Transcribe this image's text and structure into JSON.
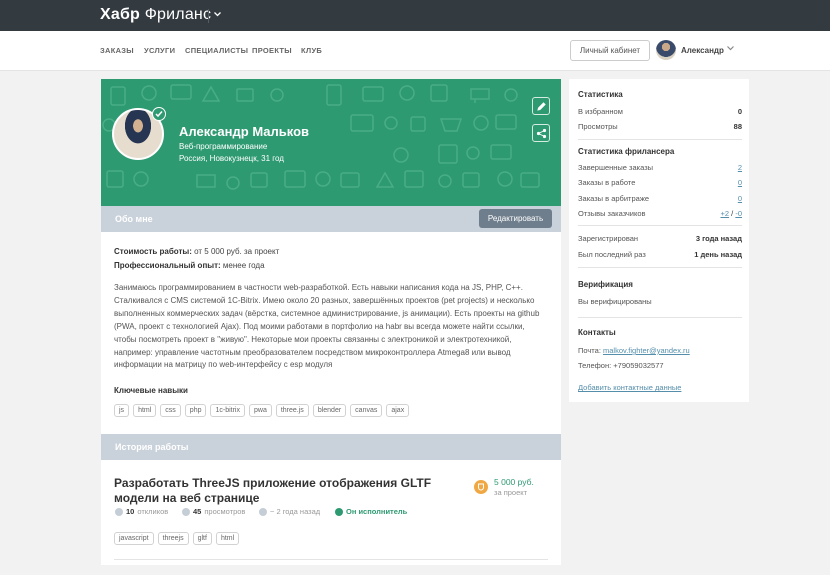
{
  "header": {
    "logo_main": "Хабр",
    "logo_sub": "Фриланс"
  },
  "nav": {
    "items": [
      "ЗАКАЗЫ",
      "УСЛУГИ",
      "СПЕЦИАЛИСТЫ",
      "ПРОЕКТЫ",
      "КЛУБ"
    ],
    "cabinet_label": "Личный кабинет",
    "user_name": "Александр"
  },
  "profile": {
    "name": "Александр Мальков",
    "specialization": "Веб-программирование",
    "location": "Россия, Новокузнецк, 31 год",
    "about_section_title": "Обо мне",
    "edit_label": "Редактировать",
    "cost_label": "Стоимость работы:",
    "cost_value": "от 5 000 руб. за проект",
    "experience_label": "Профессиональный опыт:",
    "experience_value": "менее года",
    "about_text": "Занимаюсь программированием в частности web-разработкой. Есть навыки написания кода на JS, PHP, C++. Сталкивался с CMS системой 1С-Bitrix. Имею около 20 разных, завершённых проектов (pet projects) и несколько выполненных коммерческих задач (вёрстка, системное администрирование, js анимации). Есть проекты на github (PWA, проект с технологией Ajax). Под моими работами в портфолио на habr вы всегда можете найти ссылки, чтобы посмотреть проект в \"живую\". Некоторые мои проекты связанны с электроникой и электротехникой, например: управление частотным преобразователем посредством микроконтроллера Atmega8 или вывод информации на матрицу по web-интерфейсу с esp модуля",
    "skills_title": "Ключевые навыки",
    "skills": [
      "js",
      "html",
      "css",
      "php",
      "1c-bitrix",
      "pwa",
      "three.js",
      "blender",
      "canvas",
      "ajax"
    ]
  },
  "history": {
    "section_title": "История работы",
    "order": {
      "title": "Разработать ThreeJS приложение отображения GLTF модели на веб странице",
      "price": "5 000 руб.",
      "price_note": "за проект",
      "responses_count": "10",
      "responses_label": "откликов",
      "views_count": "45",
      "views_label": "просмотров",
      "time": "~ 2 года назад",
      "status": "Он исполнитель",
      "tags": [
        "javascript",
        "threejs",
        "gltf",
        "html"
      ]
    }
  },
  "sidebar": {
    "stats_title": "Статистика",
    "stats": [
      {
        "label": "В избранном",
        "value": "0"
      },
      {
        "label": "Просмотры",
        "value": "88"
      }
    ],
    "freelancer_title": "Статистика фрилансера",
    "freelancer": [
      {
        "label": "Завершенные заказы",
        "value": "2"
      },
      {
        "label": "Заказы в работе",
        "value": "0"
      },
      {
        "label": "Заказы в арбитраже",
        "value": "0"
      }
    ],
    "reviews_label": "Отзывы заказчиков",
    "reviews_pos": "+2",
    "reviews_sep": "/",
    "reviews_neg": "-0",
    "registered_label": "Зарегистрирован",
    "registered_value": "3 года назад",
    "last_seen_label": "Был последний раз",
    "last_seen_value": "1 день назад",
    "verification_title": "Верификация",
    "verification_text": "Вы верифицированы",
    "contacts_title": "Контакты",
    "email_label": "Почта:",
    "email_value": "malkov.fighter@yandex.ru",
    "phone_label": "Телефон:",
    "phone_value": "+79059032577",
    "add_contacts_label": "Добавить контактные данные"
  },
  "colors": {
    "topbar": "#333a40",
    "cover_green": "#2e9a72",
    "section_bar": "#c9d1da",
    "link": "#548eaa",
    "price_orange": "#f0a844"
  }
}
